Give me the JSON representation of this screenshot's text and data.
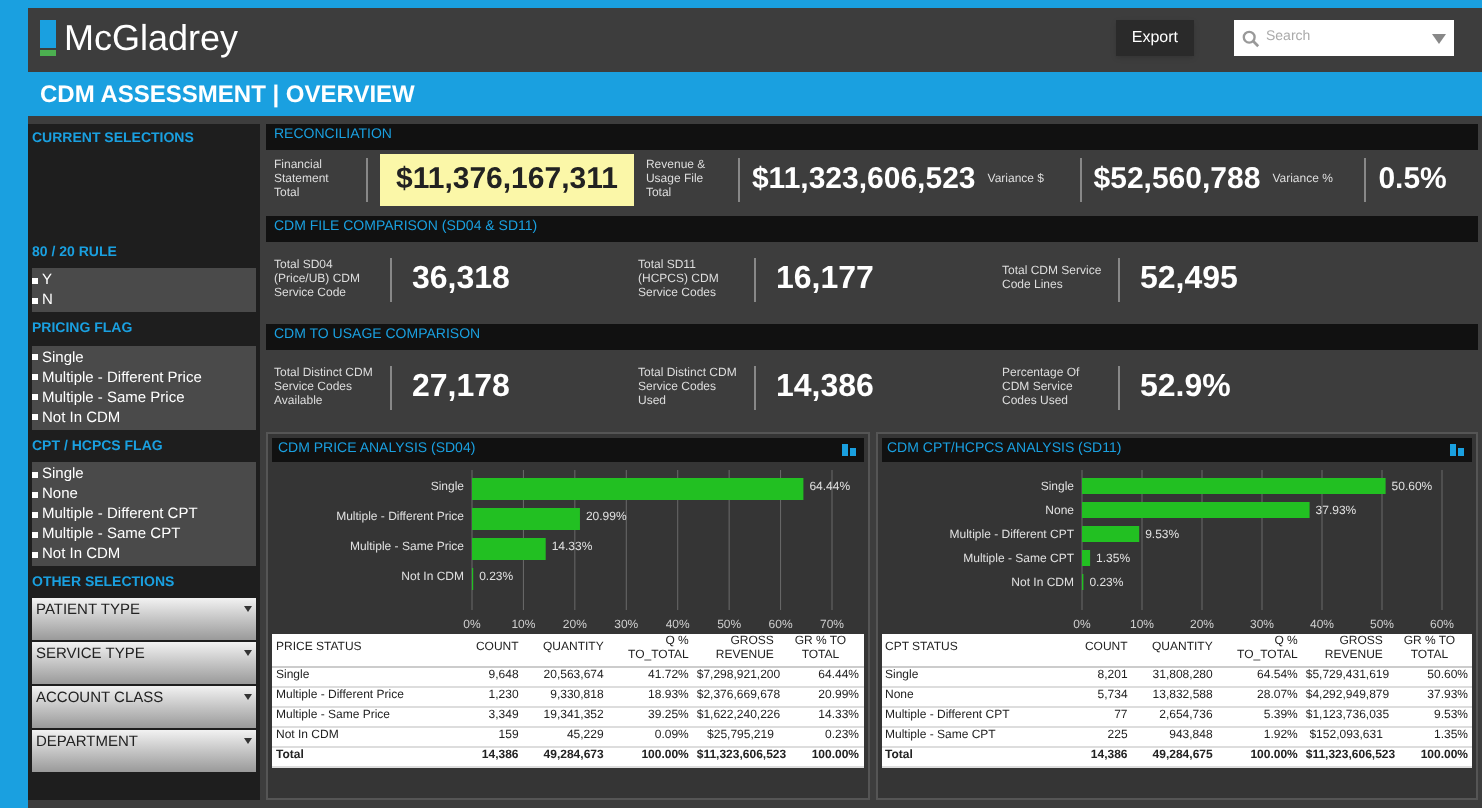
{
  "header": {
    "logo": "McGladrey",
    "export_button": "Export",
    "search": {
      "placeholder": "Search"
    }
  },
  "title": "CDM ASSESSMENT | OVERVIEW",
  "sidebar": {
    "current_selections": "CURRENT SELECTIONS",
    "filters": [
      {
        "title": "80 / 20 RULE",
        "items": [
          "Y",
          "N"
        ]
      },
      {
        "title": "PRICING FLAG",
        "items": [
          "Single",
          "Multiple - Different Price",
          "Multiple - Same Price",
          "Not In CDM"
        ]
      },
      {
        "title": "CPT / HCPCS FLAG",
        "items": [
          "Single",
          "None",
          "Multiple - Different CPT",
          "Multiple - Same CPT",
          "Not In CDM"
        ]
      }
    ],
    "other_selections": {
      "title": "OTHER SELECTIONS",
      "dropdowns": [
        "PATIENT TYPE",
        "SERVICE TYPE",
        "ACCOUNT CLASS",
        "DEPARTMENT"
      ]
    }
  },
  "sections": [
    {
      "title": "RECONCILIATION",
      "metrics": [
        {
          "label": "Financial Statement Total",
          "value": "$11,376,167,311",
          "highlighted": true
        },
        {
          "label": "Revenue & Usage File Total",
          "value": "$11,323,606,523",
          "highlighted": false
        },
        {
          "label": "Variance $",
          "value": "$52,560,788",
          "highlighted": false
        },
        {
          "label": "Variance %",
          "value": "0.5%",
          "highlighted": false
        }
      ]
    },
    {
      "title": "CDM FILE COMPARISON (SD04 & SD11)",
      "metrics": [
        {
          "label": "Total SD04 (Price/UB) CDM Service Code",
          "value": "36,318",
          "highlighted": false
        },
        {
          "label": "Total SD11 (HCPCS) CDM Service Codes",
          "value": "16,177",
          "highlighted": false
        },
        {
          "label": "Total CDM Service Code Lines",
          "value": "52,495",
          "highlighted": false
        }
      ]
    },
    {
      "title": "CDM TO USAGE COMPARISON",
      "metrics": [
        {
          "label": "Total Distinct CDM Service Codes Available",
          "value": "27,178",
          "highlighted": false
        },
        {
          "label": "Total Distinct CDM Service Codes Used",
          "value": "14,386",
          "highlighted": false
        },
        {
          "label": "Percentage Of CDM Service Codes Used",
          "value": "52.9%",
          "highlighted": false
        }
      ]
    }
  ],
  "charts": [
    {
      "title": "CDM PRICE ANALYSIS (SD04)",
      "chart_data": {
        "type": "bar",
        "orientation": "horizontal",
        "categories": [
          "Single",
          "Multiple - Different Price",
          "Multiple - Same Price",
          "Not In CDM"
        ],
        "values": [
          64.44,
          20.99,
          14.33,
          0.23
        ],
        "grid": true,
        "value_labels": [
          "64.44%",
          "20.99%",
          "14.33%",
          "0.23%"
        ],
        "xlim": [
          0,
          70
        ],
        "xticks": [
          {
            "value": 0,
            "label": "0%"
          },
          {
            "value": 10,
            "label": "10%"
          },
          {
            "value": 20,
            "label": "20%"
          },
          {
            "value": 30,
            "label": "30%"
          },
          {
            "value": 40,
            "label": "40%"
          },
          {
            "value": 50,
            "label": "50%"
          },
          {
            "value": 60,
            "label": "60%"
          },
          {
            "value": 70,
            "label": "70%"
          }
        ]
      },
      "table": {
        "columns": [
          "PRICE STATUS",
          "COUNT",
          "QUANTITY",
          "Q % TO_TOTAL",
          "GROSS REVENUE",
          "GR % TO TOTAL"
        ],
        "rows": [
          {
            "kind": "data",
            "cells": [
              "Single",
              "9,648",
              "20,563,674",
              "41.72%",
              "$7,298,921,200",
              "64.44%"
            ]
          },
          {
            "kind": "data",
            "cells": [
              "Multiple - Different Price",
              "1,230",
              "9,330,818",
              "18.93%",
              "$2,376,669,678",
              "20.99%"
            ]
          },
          {
            "kind": "data",
            "cells": [
              "Multiple - Same Price",
              "3,349",
              "19,341,352",
              "39.25%",
              "$1,622,240,226",
              "14.33%"
            ]
          },
          {
            "kind": "data",
            "cells": [
              "Not In CDM",
              "159",
              "45,229",
              "0.09%",
              "$25,795,219",
              "0.23%"
            ]
          },
          {
            "kind": "total",
            "cells": [
              "Total",
              "14,386",
              "49,284,673",
              "100.00%",
              "$11,323,606,523",
              "100.00%"
            ]
          }
        ]
      }
    },
    {
      "title": "CDM CPT/HCPCS ANALYSIS (SD11)",
      "chart_data": {
        "type": "bar",
        "orientation": "horizontal",
        "categories": [
          "Single",
          "None",
          "Multiple - Different CPT",
          "Multiple - Same CPT",
          "Not In CDM"
        ],
        "values": [
          50.6,
          37.93,
          9.53,
          1.35,
          0.23
        ],
        "grid": true,
        "value_labels": [
          "50.60%",
          "37.93%",
          "9.53%",
          "1.35%",
          "0.23%"
        ],
        "xlim": [
          0,
          60
        ],
        "xticks": [
          {
            "value": 0,
            "label": "0%"
          },
          {
            "value": 10,
            "label": "10%"
          },
          {
            "value": 20,
            "label": "20%"
          },
          {
            "value": 30,
            "label": "30%"
          },
          {
            "value": 40,
            "label": "40%"
          },
          {
            "value": 50,
            "label": "50%"
          },
          {
            "value": 60,
            "label": "60%"
          }
        ]
      },
      "table": {
        "columns": [
          "CPT STATUS",
          "COUNT",
          "QUANTITY",
          "Q % TO_TOTAL",
          "GROSS REVENUE",
          "GR % TO TOTAL"
        ],
        "rows": [
          {
            "kind": "data",
            "cells": [
              "Single",
              "8,201",
              "31,808,280",
              "64.54%",
              "$5,729,431,619",
              "50.60%"
            ]
          },
          {
            "kind": "data",
            "cells": [
              "None",
              "5,734",
              "13,832,588",
              "28.07%",
              "$4,292,949,879",
              "37.93%"
            ]
          },
          {
            "kind": "data",
            "cells": [
              "Multiple - Different CPT",
              "77",
              "2,654,736",
              "5.39%",
              "$1,123,736,035",
              "9.53%"
            ]
          },
          {
            "kind": "data",
            "cells": [
              "Multiple - Same CPT",
              "225",
              "943,848",
              "1.92%",
              "$152,093,631",
              "1.35%"
            ]
          },
          {
            "kind": "total",
            "cells": [
              "Total",
              "14,386",
              "49,284,675",
              "100.00%",
              "$11,323,606,523",
              "100.00%"
            ]
          }
        ]
      }
    }
  ]
}
